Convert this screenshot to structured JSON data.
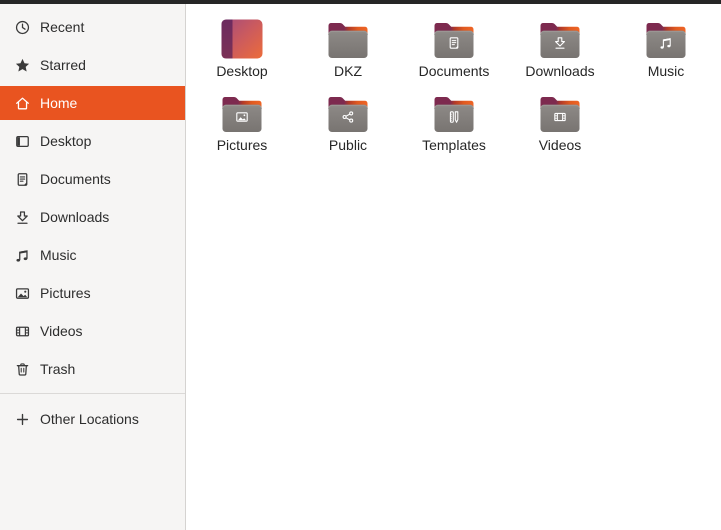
{
  "sidebar": {
    "items": [
      {
        "label": "Recent",
        "icon": "recent-icon",
        "selected": false
      },
      {
        "label": "Starred",
        "icon": "star-icon",
        "selected": false
      },
      {
        "label": "Home",
        "icon": "home-icon",
        "selected": true
      },
      {
        "label": "Desktop",
        "icon": "desktop-icon",
        "selected": false
      },
      {
        "label": "Documents",
        "icon": "documents-icon",
        "selected": false
      },
      {
        "label": "Downloads",
        "icon": "downloads-icon",
        "selected": false
      },
      {
        "label": "Music",
        "icon": "music-icon",
        "selected": false
      },
      {
        "label": "Pictures",
        "icon": "pictures-icon",
        "selected": false
      },
      {
        "label": "Videos",
        "icon": "videos-icon",
        "selected": false
      },
      {
        "label": "Trash",
        "icon": "trash-icon",
        "selected": false
      }
    ],
    "footer_item": {
      "label": "Other Locations",
      "icon": "plus-icon"
    }
  },
  "files": {
    "items": [
      {
        "label": "Desktop",
        "kind": "desktop-gradient",
        "emblem": ""
      },
      {
        "label": "DKZ",
        "kind": "folder",
        "emblem": ""
      },
      {
        "label": "Documents",
        "kind": "folder",
        "emblem": "documents"
      },
      {
        "label": "Downloads",
        "kind": "folder",
        "emblem": "downloads"
      },
      {
        "label": "Music",
        "kind": "folder",
        "emblem": "music"
      },
      {
        "label": "Pictures",
        "kind": "folder",
        "emblem": "pictures"
      },
      {
        "label": "Public",
        "kind": "folder",
        "emblem": "public"
      },
      {
        "label": "Templates",
        "kind": "folder",
        "emblem": "templates"
      },
      {
        "label": "Videos",
        "kind": "folder",
        "emblem": "videos"
      }
    ]
  },
  "colors": {
    "accent_orange": "#E95420",
    "sidebar_bg": "#f6f5f4",
    "titlebar_edge": "#262626",
    "folder_gray": "#868380",
    "folder_tab_maroon": "#7d2a4f",
    "folder_back_orange": "#ef6526",
    "main_bg": "#ffffff"
  }
}
